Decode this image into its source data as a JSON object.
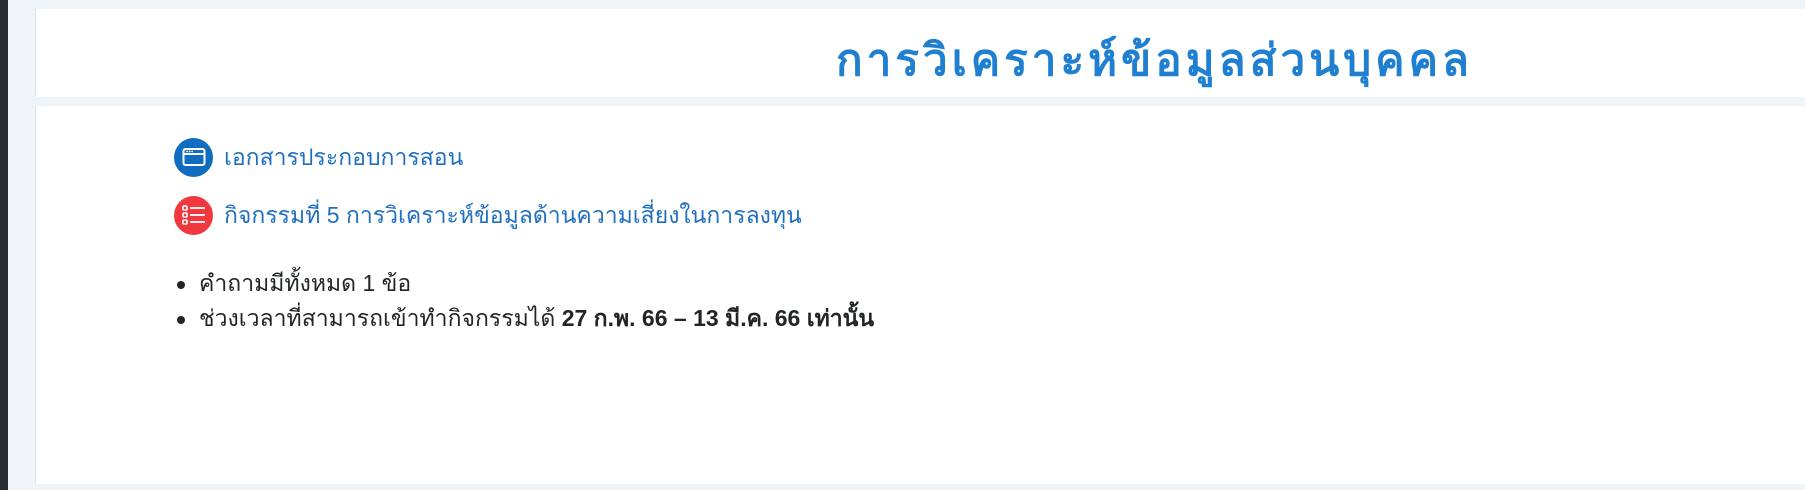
{
  "header": {
    "title": "การวิเคราะห์ข้อมูลส่วนบุคคล"
  },
  "activities": [
    {
      "icon": "browser-window-icon",
      "type": "resource",
      "label": "เอกสารประกอบการสอน",
      "icon_color": "#0f6cbf"
    },
    {
      "icon": "checklist-icon",
      "type": "quiz",
      "label": "กิจกรรมที่ 5 การวิเคราะห์ข้อมูลด้านความเสี่ยงในการลงทุน",
      "icon_color": "#f0383e"
    }
  ],
  "info": {
    "question_count": "คำถามมีทั้งหมด 1 ข้อ",
    "time_window_prefix": "ช่วงเวลาที่สามารถเข้าทำกิจกรรมได้",
    "time_window_dates": "27 ก.พ. 66 – 13 มี.ค. 66 เท่านั้น"
  },
  "colors": {
    "title": "#1f7fd0",
    "link": "#1f6fc2",
    "text": "#222528",
    "background": "#eef4f8"
  }
}
